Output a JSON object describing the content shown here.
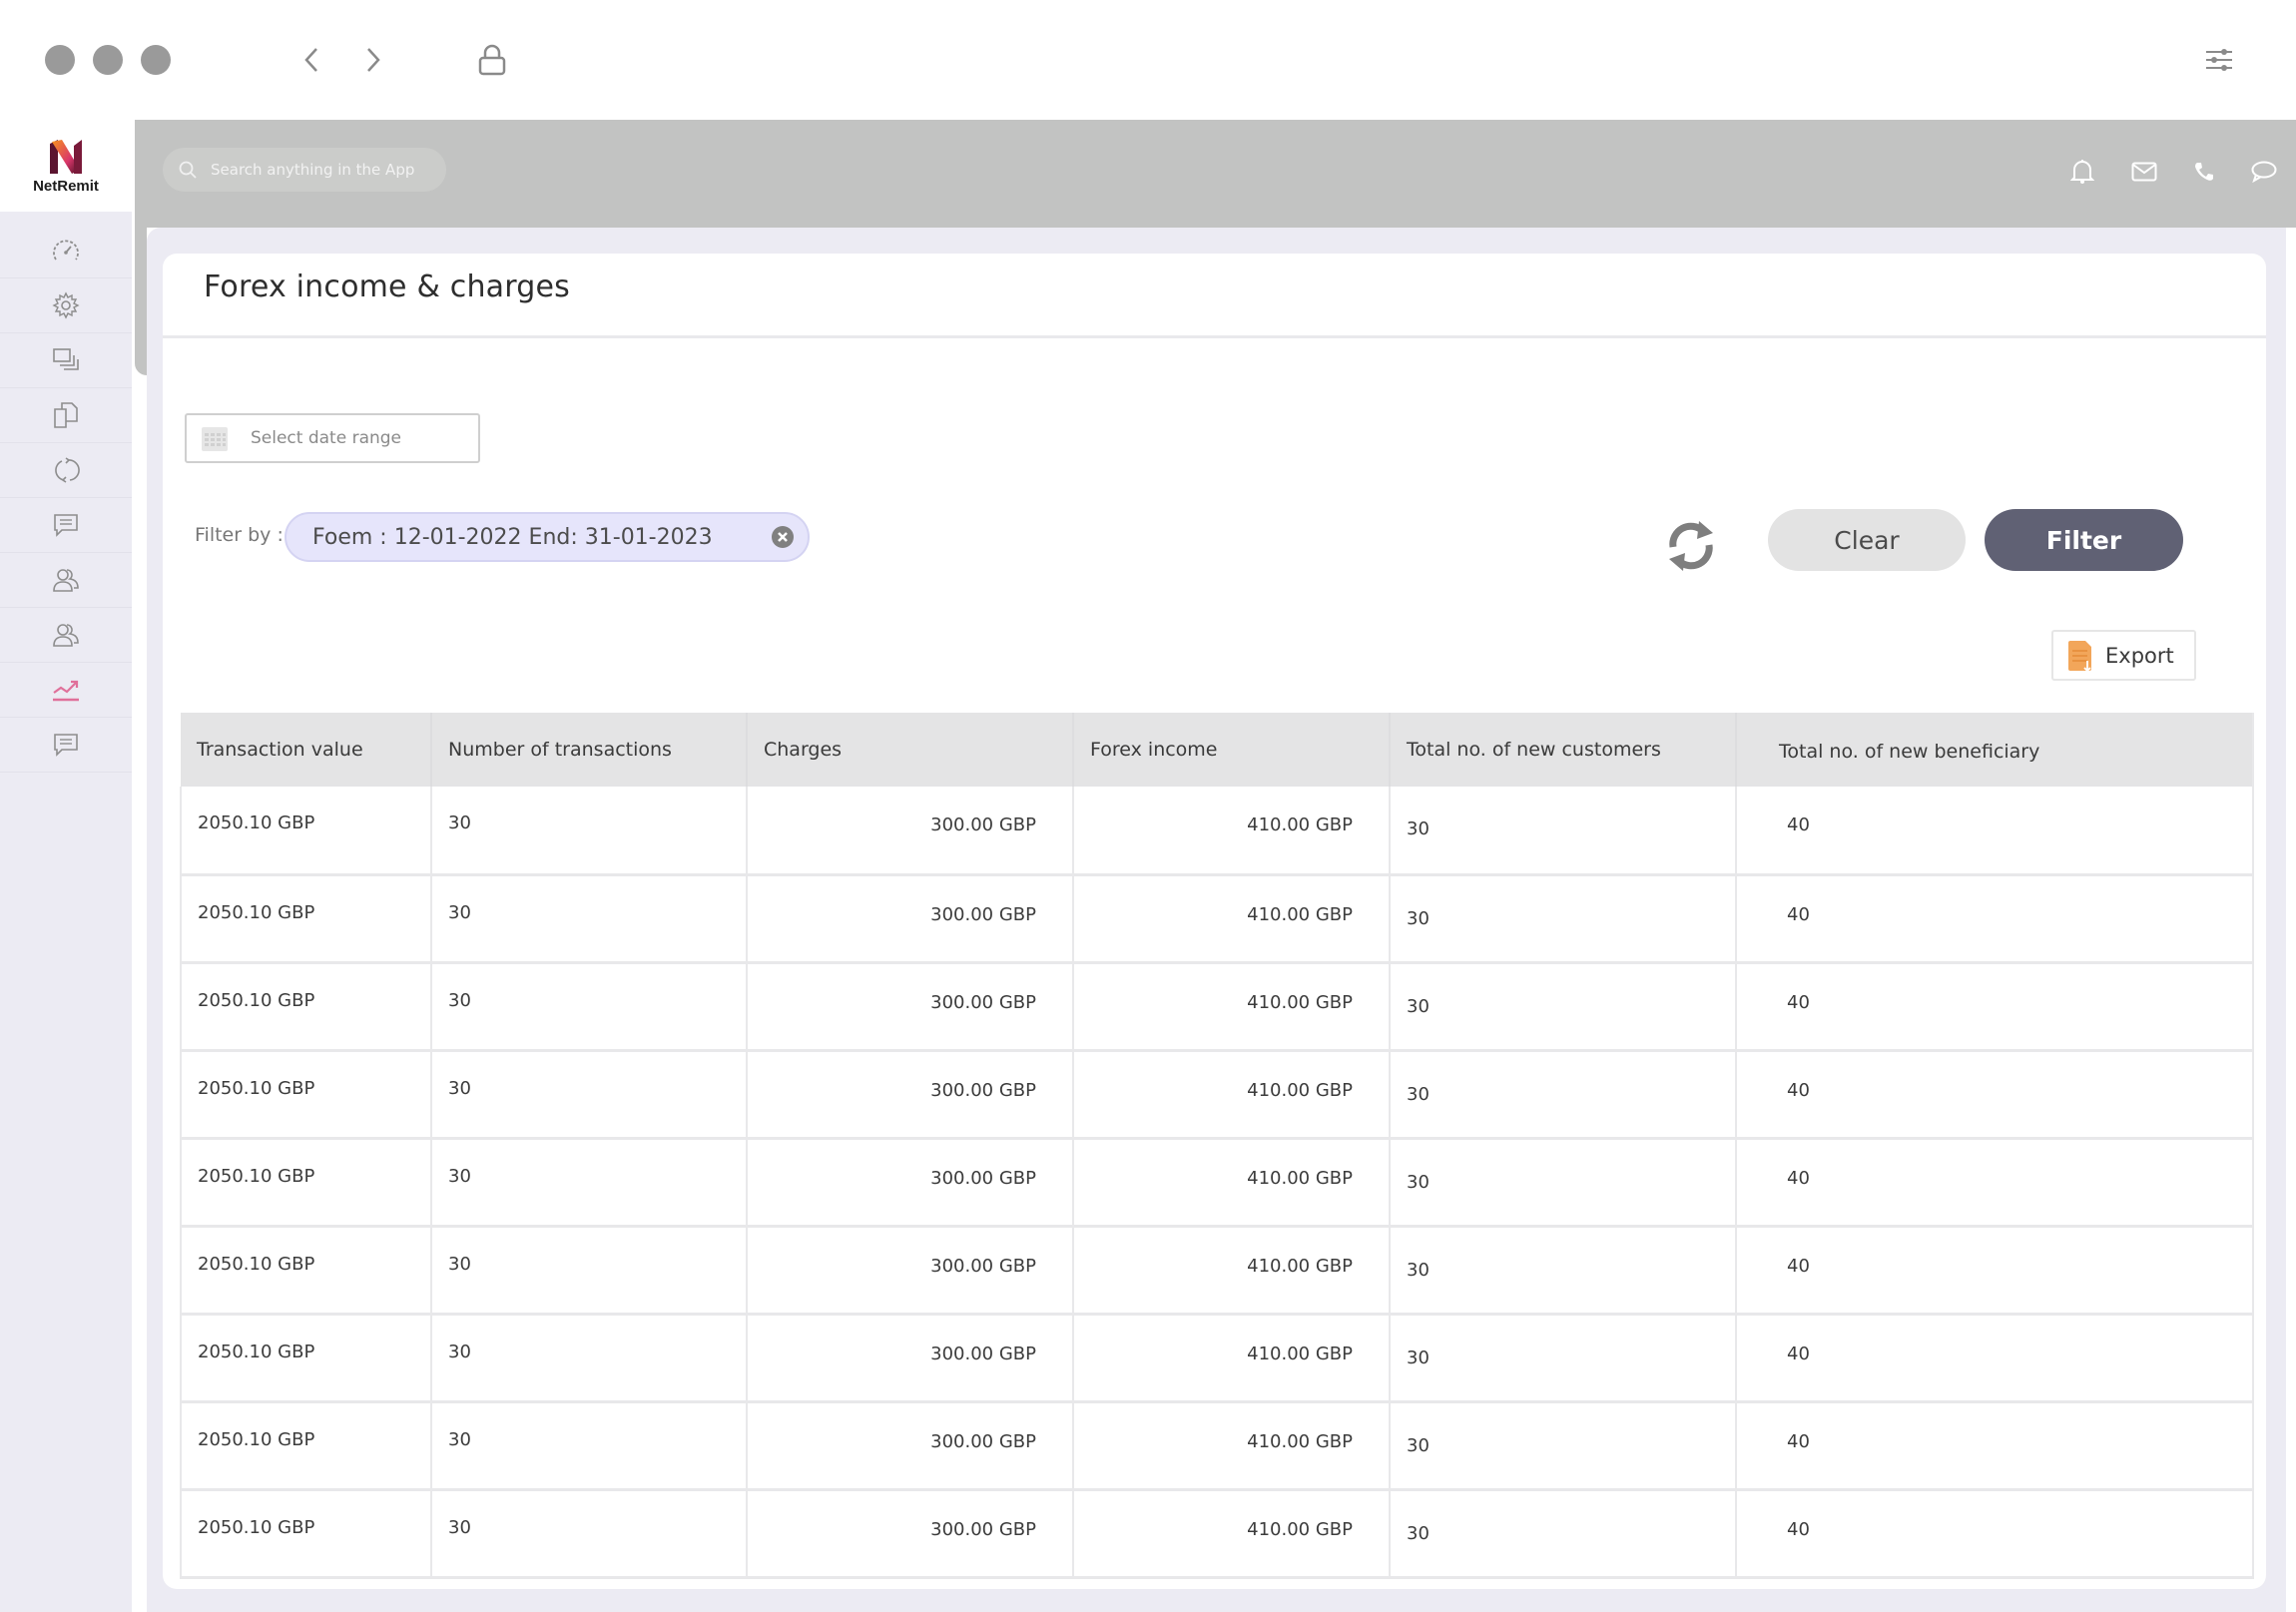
{
  "browser": {
    "nav_back": "back",
    "nav_forward": "forward",
    "icons": [
      "chevron-left-icon",
      "chevron-right-icon",
      "lock-icon",
      "sliders-icon"
    ]
  },
  "app": {
    "brand_name": "NetRemit",
    "brand_colors": {
      "orange": "#f7941d",
      "magenta": "#c2185b",
      "dark": "#3a0d1c"
    }
  },
  "sidebar": {
    "active_index": 8,
    "active_color": "#e0709a",
    "items": [
      {
        "name": "dashboard",
        "icon": "speedometer-icon"
      },
      {
        "name": "settings",
        "icon": "gear-icon"
      },
      {
        "name": "windows",
        "icon": "stacked-windows-icon"
      },
      {
        "name": "documents",
        "icon": "copy-documents-icon"
      },
      {
        "name": "exchange",
        "icon": "refresh-cycle-icon"
      },
      {
        "name": "messages",
        "icon": "chat-icon"
      },
      {
        "name": "customers",
        "icon": "users-icon"
      },
      {
        "name": "beneficiaries",
        "icon": "users-icon"
      },
      {
        "name": "reports",
        "icon": "trend-chart-icon"
      },
      {
        "name": "support",
        "icon": "chat-icon"
      }
    ]
  },
  "header": {
    "search_placeholder": "Search anything in the App",
    "icons": [
      "bell-icon",
      "mail-icon",
      "phone-icon",
      "chat-bubble-icon"
    ]
  },
  "page": {
    "title": "Forex income & charges",
    "date_range_placeholder": "Select date range",
    "filter_by_label": "Filter by :",
    "filter_chip": "Foem : 12-01-2022 End: 31-01-2023",
    "clear_label": "Clear",
    "filter_label": "Filter",
    "export_label": "Export"
  },
  "table": {
    "columns": [
      "Transaction value",
      "Number of transactions",
      "Charges",
      "Forex income",
      "Total no. of new customers",
      "Total no. of new beneficiary"
    ],
    "rows": [
      [
        "2050.10 GBP",
        "30",
        "300.00 GBP",
        "410.00 GBP",
        "30",
        "40"
      ],
      [
        "2050.10 GBP",
        "30",
        "300.00 GBP",
        "410.00 GBP",
        "30",
        "40"
      ],
      [
        "2050.10 GBP",
        "30",
        "300.00 GBP",
        "410.00 GBP",
        "30",
        "40"
      ],
      [
        "2050.10 GBP",
        "30",
        "300.00 GBP",
        "410.00 GBP",
        "30",
        "40"
      ],
      [
        "2050.10 GBP",
        "30",
        "300.00 GBP",
        "410.00 GBP",
        "30",
        "40"
      ],
      [
        "2050.10 GBP",
        "30",
        "300.00 GBP",
        "410.00 GBP",
        "30",
        "40"
      ],
      [
        "2050.10 GBP",
        "30",
        "300.00 GBP",
        "410.00 GBP",
        "30",
        "40"
      ],
      [
        "2050.10 GBP",
        "30",
        "300.00 GBP",
        "410.00 GBP",
        "30",
        "40"
      ],
      [
        "2050.10 GBP",
        "30",
        "300.00 GBP",
        "410.00 GBP",
        "30",
        "40"
      ]
    ]
  },
  "colors": {
    "header_gray": "#c2c3c2",
    "page_bg": "#ecebf3",
    "filter_button": "#606174",
    "clear_button": "#e3e3e3",
    "chip_bg": "#e6e5fb",
    "export_icon": "#f2a65a"
  }
}
